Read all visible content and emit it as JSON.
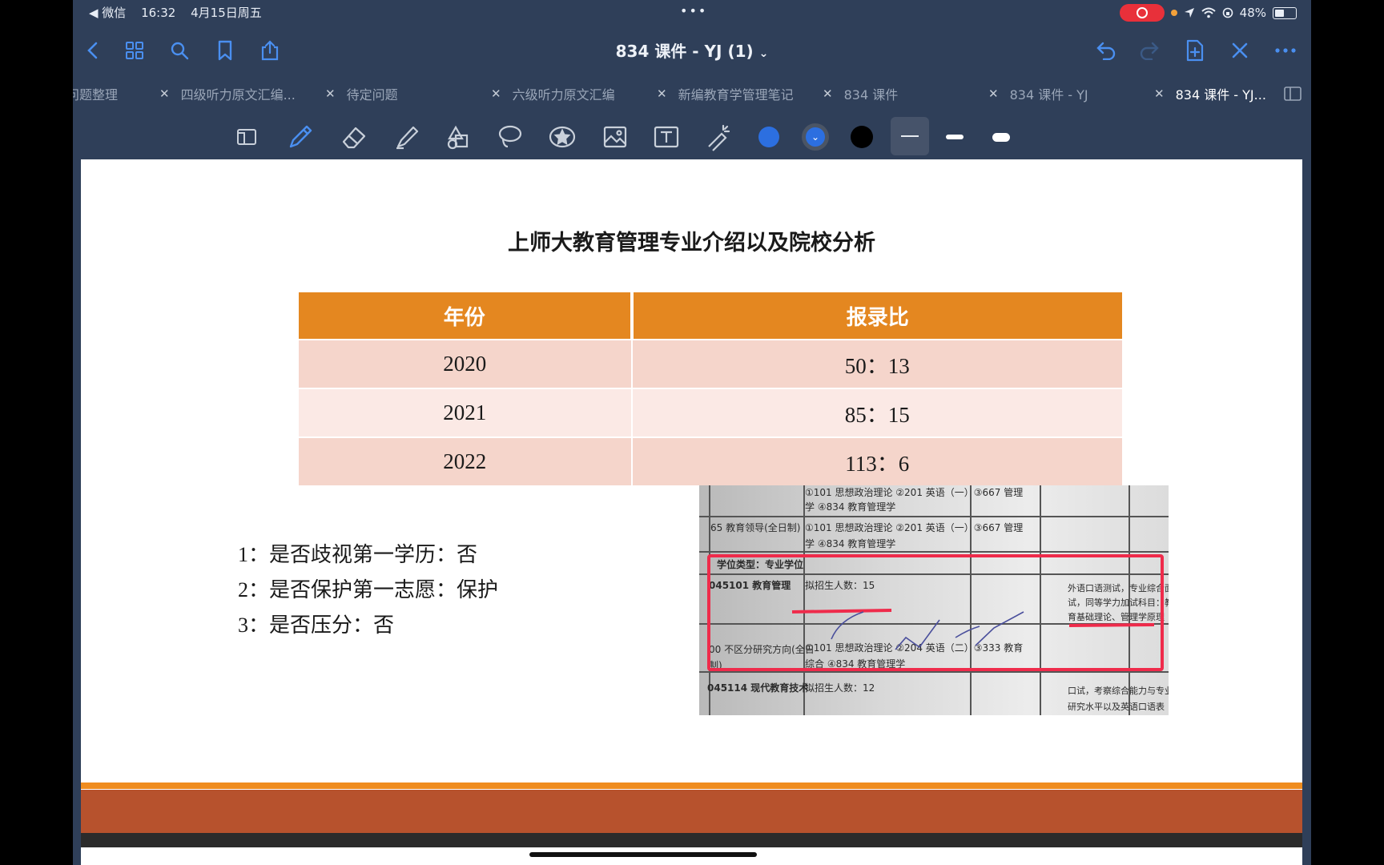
{
  "status_bar": {
    "back_app": "◀ 微信",
    "time": "16:32",
    "date": "4月15日周五",
    "battery": "48%"
  },
  "nav": {
    "title": "834 课件 - YJ (1)",
    "title_chevron": "⌄"
  },
  "tabs": [
    {
      "label": "问题整理"
    },
    {
      "label": "四级听力原文汇编..."
    },
    {
      "label": "待定问题"
    },
    {
      "label": "六级听力原文汇编"
    },
    {
      "label": "新编教育学管理笔记"
    },
    {
      "label": "834 课件"
    },
    {
      "label": "834 课件 - YJ"
    },
    {
      "label": "834 课件 - YJ..."
    }
  ],
  "colors": {
    "accent": "#4a8ff0",
    "app_bg": "#2f3f59",
    "table_header": "#e48720",
    "row_odd": "#f5d5cb",
    "row_even": "#fbe9e5",
    "footer_line": "#ef8c1f",
    "footer_band": "#b7522d",
    "pen_blue": "#2c6fe0",
    "highlight_red": "#ef2b4b"
  },
  "slide": {
    "title": "上师大教育管理专业介绍以及院校分析",
    "table": {
      "headers": [
        "年份",
        "报录比"
      ],
      "rows": [
        [
          "2020",
          "50：13"
        ],
        [
          "2021",
          "85：15"
        ],
        [
          "2022",
          "113：6"
        ]
      ]
    },
    "notes": [
      {
        "num": "1：",
        "text": "是否歧视第一学历：否"
      },
      {
        "num": "2：",
        "text": "是否保护第一志愿：保护"
      },
      {
        "num": "3：",
        "text": "是否压分：否"
      }
    ],
    "scan": {
      "row1": "①101 思想政治理论 ②201 英语（一）③667 管理",
      "row1b": "学 ④834 教育管理学",
      "row2_left": "65 教育领导(全日制)",
      "row2": "①101 思想政治理论 ②201 英语（一）③667 管理",
      "row2b": "学 ④834 教育管理学",
      "degree_type": "学位类型：专业学位",
      "program": "045101 教育管理",
      "planned": "拟招生人数：15",
      "right_note_1": "外语口语测试，专业综合面",
      "right_note_2": "试，同等学力加试科目：教",
      "right_note_3": "育基础理论、管理学原理",
      "direction": "00 不区分研究方向(全日",
      "direction_b": "制)",
      "subjects": "①101 思想政治理论 ②204 英语（二）③333 教育",
      "subjects_b": "综合 ④834 教育管理学",
      "program2": "045114 现代教育技术",
      "planned2": "拟招生人数：12",
      "right_note_4": "口试，考察综合能力与专业",
      "right_note_5": "研究水平以及英语口语表"
    }
  }
}
